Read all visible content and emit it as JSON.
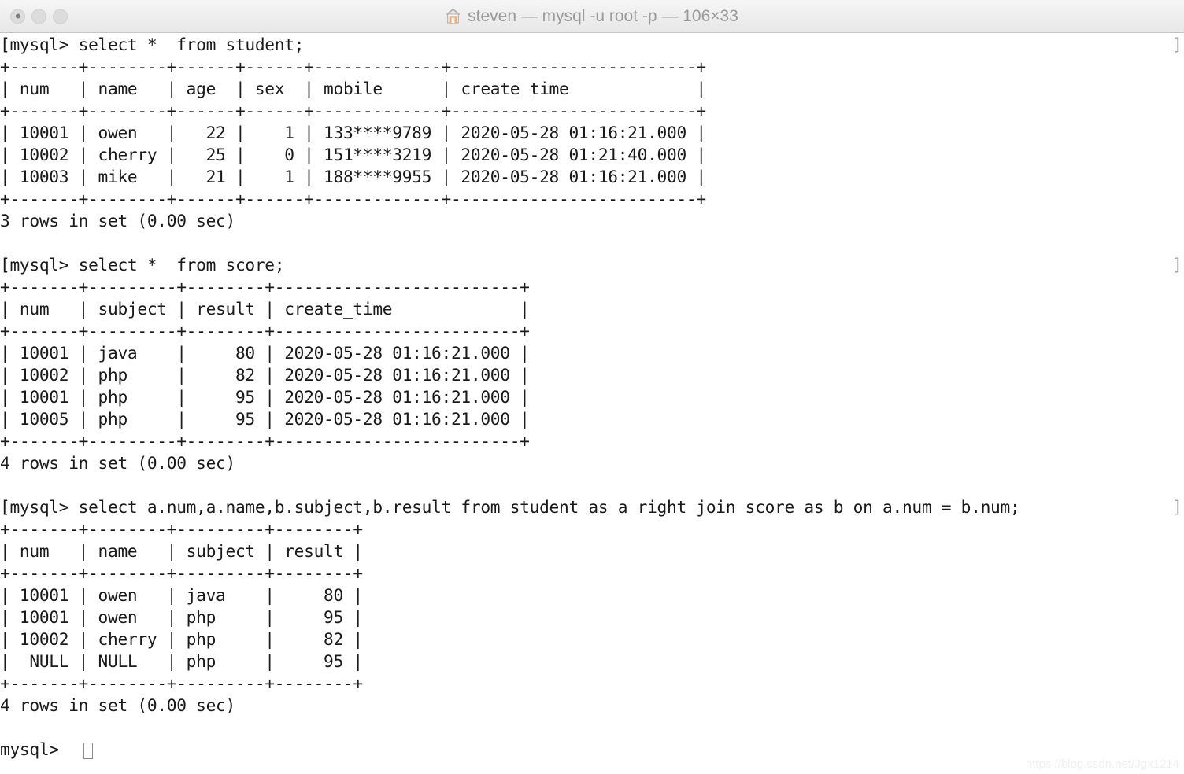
{
  "window": {
    "title": "steven — mysql -u root -p — 106×33",
    "title_icon": "home-icon",
    "cols": 106,
    "rows": 33,
    "traffic_lights": [
      {
        "name": "close-button",
        "label": "Close",
        "color": "#dcdcdc",
        "has_dot": true
      },
      {
        "name": "minimize-button",
        "label": "Minimize",
        "color": "#dcdcdc",
        "has_dot": false
      },
      {
        "name": "zoom-button",
        "label": "Zoom",
        "color": "#dcdcdc",
        "has_dot": false
      }
    ]
  },
  "colors": {
    "background": "#ffffff",
    "foreground": "#1a1a1a",
    "titlebar_text": "#9a9a9a",
    "prompt_mark": "#a8a8a8",
    "watermark": "#efefef"
  },
  "terminal": {
    "prompt": "mysql>",
    "blocks": [
      {
        "command": "select *  from student;",
        "result_status": "3 rows in set (0.00 sec)",
        "columns": [
          "num",
          "name",
          "age",
          "sex",
          "mobile",
          "create_time"
        ],
        "rows": [
          [
            "10001",
            "owen",
            "22",
            "1",
            "133****9789",
            "2020-05-28 01:16:21.000"
          ],
          [
            "10002",
            "cherry",
            "25",
            "0",
            "151****3219",
            "2020-05-28 01:21:40.000"
          ],
          [
            "10003",
            "mike",
            "21",
            "1",
            "188****9955",
            "2020-05-28 01:16:21.000"
          ]
        ]
      },
      {
        "command": "select *  from score;",
        "result_status": "4 rows in set (0.00 sec)",
        "columns": [
          "num",
          "subject",
          "result",
          "create_time"
        ],
        "rows": [
          [
            "10001",
            "java",
            "80",
            "2020-05-28 01:16:21.000"
          ],
          [
            "10002",
            "php",
            "82",
            "2020-05-28 01:16:21.000"
          ],
          [
            "10001",
            "php",
            "95",
            "2020-05-28 01:16:21.000"
          ],
          [
            "10005",
            "php",
            "95",
            "2020-05-28 01:16:21.000"
          ]
        ]
      },
      {
        "command": "select a.num,a.name,b.subject,b.result from student as a right join score as b on a.num = b.num;",
        "result_status": "4 rows in set (0.00 sec)",
        "columns": [
          "num",
          "name",
          "subject",
          "result"
        ],
        "rows": [
          [
            "10001",
            "owen",
            "java",
            "80"
          ],
          [
            "10001",
            "owen",
            "php",
            "95"
          ],
          [
            "10002",
            "cherry",
            "php",
            "82"
          ],
          [
            "NULL",
            "NULL",
            "php",
            "95"
          ]
        ]
      }
    ],
    "screen": "[mysql> select *  from student;\n+-------+--------+------+------+-------------+-------------------------+\n| num   | name   | age  | sex  | mobile      | create_time             |\n+-------+--------+------+------+-------------+-------------------------+\n| 10001 | owen   |   22 |    1 | 133****9789 | 2020-05-28 01:16:21.000 |\n| 10002 | cherry |   25 |    0 | 151****3219 | 2020-05-28 01:21:40.000 |\n| 10003 | mike   |   21 |    1 | 188****9955 | 2020-05-28 01:16:21.000 |\n+-------+--------+------+------+-------------+-------------------------+\n3 rows in set (0.00 sec)\n\n[mysql> select *  from score;\n+-------+---------+--------+-------------------------+\n| num   | subject | result | create_time             |\n+-------+---------+--------+-------------------------+\n| 10001 | java    |     80 | 2020-05-28 01:16:21.000 |\n| 10002 | php     |     82 | 2020-05-28 01:16:21.000 |\n| 10001 | php     |     95 | 2020-05-28 01:16:21.000 |\n| 10005 | php     |     95 | 2020-05-28 01:16:21.000 |\n+-------+---------+--------+-------------------------+\n4 rows in set (0.00 sec)\n\n[mysql> select a.num,a.name,b.subject,b.result from student as a right join score as b on a.num = b.num;\n+-------+--------+---------+--------+\n| num   | name   | subject | result |\n+-------+--------+---------+--------+\n| 10001 | owen   | java    |     80 |\n| 10001 | owen   | php     |     95 |\n| 10002 | cherry | php     |     82 |\n|  NULL | NULL   | php     |     95 |\n+-------+--------+---------+--------+\n4 rows in set (0.00 sec)\n\nmysql> ",
    "edge_marks": [
      "]",
      "]",
      "]"
    ],
    "cursor": "block-hollow"
  },
  "watermark": {
    "text": "https://blog.csdn.net/Jgx1214"
  }
}
